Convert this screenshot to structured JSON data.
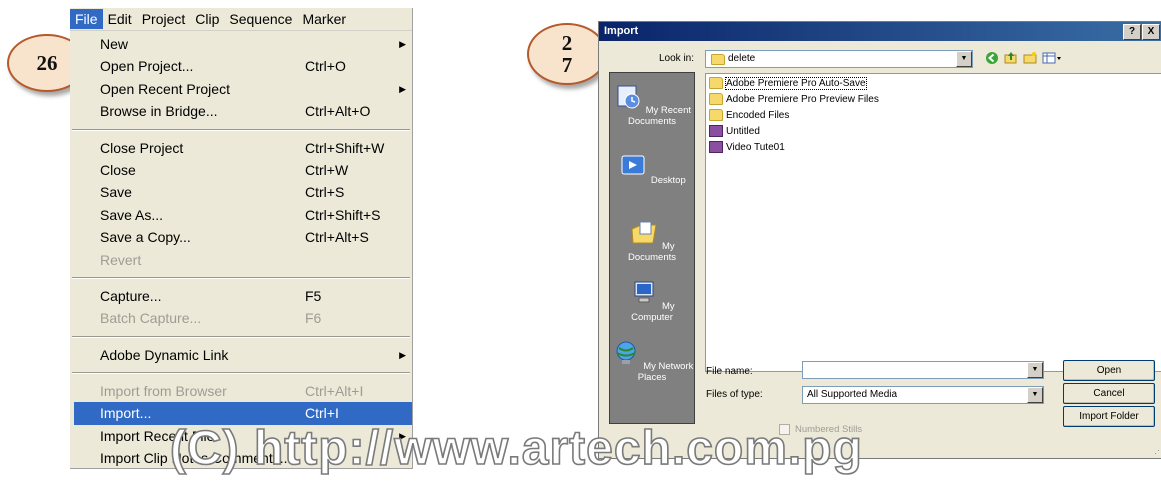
{
  "badges": {
    "step1": "26",
    "step2_line1": "2",
    "step2_line2": "7"
  },
  "menubar": {
    "items": [
      "File",
      "Edit",
      "Project",
      "Clip",
      "Sequence",
      "Marker"
    ]
  },
  "file_menu": {
    "new": "New",
    "open_project": "Open Project...",
    "open_project_sc": "Ctrl+O",
    "open_recent": "Open Recent Project",
    "browse_bridge": "Browse in Bridge...",
    "browse_bridge_sc": "Ctrl+Alt+O",
    "close_project": "Close Project",
    "close_project_sc": "Ctrl+Shift+W",
    "close": "Close",
    "close_sc": "Ctrl+W",
    "save": "Save",
    "save_sc": "Ctrl+S",
    "save_as": "Save As...",
    "save_as_sc": "Ctrl+Shift+S",
    "save_copy": "Save a Copy...",
    "save_copy_sc": "Ctrl+Alt+S",
    "revert": "Revert",
    "capture": "Capture...",
    "capture_sc": "F5",
    "batch_capture": "Batch Capture...",
    "batch_capture_sc": "F6",
    "dynamic_link": "Adobe Dynamic Link",
    "import_browser": "Import from Browser",
    "import_browser_sc": "Ctrl+Alt+I",
    "import": "Import...",
    "import_sc": "Ctrl+I",
    "import_recent": "Import Recent File",
    "import_clip_notes": "Import Clip Notes Comments..."
  },
  "dialog": {
    "title": "Import",
    "help_btn": "?",
    "close_btn": "X",
    "look_in_label": "Look in:",
    "look_in_value": "delete",
    "places": [
      "My Recent Documents",
      "Desktop",
      "My Documents",
      "My Computer",
      "My Network Places"
    ],
    "files": [
      {
        "name": "Adobe Premiere Pro Auto-Save",
        "kind": "folder"
      },
      {
        "name": "Adobe Premiere Pro Preview Files",
        "kind": "folder"
      },
      {
        "name": "Encoded Files",
        "kind": "folder"
      },
      {
        "name": "Untitled",
        "kind": "project"
      },
      {
        "name": "Video Tute01",
        "kind": "project"
      }
    ],
    "file_name_label": "File name:",
    "file_name_value": "",
    "files_of_type_label": "Files of type:",
    "files_of_type_value": "All Supported Media",
    "numbered_stills": "Numbered Stills",
    "open_btn": "Open",
    "cancel_btn": "Cancel",
    "import_folder_btn": "Import Folder"
  },
  "watermark": "(C) http://www.artech.com.pg",
  "colors": {
    "menu_bg": "#ece9d8",
    "highlight": "#316ac5",
    "disabled": "#a09c94",
    "title_dark": "#0a246a",
    "places_bg": "#808080",
    "badge_fill": "#f8e3cc",
    "badge_border": "#b45a2a"
  }
}
